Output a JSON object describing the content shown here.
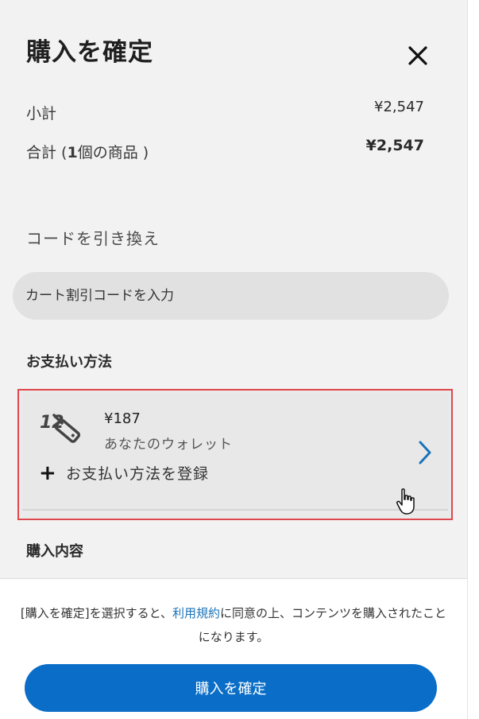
{
  "header": {
    "title": "購入を確定",
    "close_icon": "close-icon"
  },
  "summary": {
    "subtotal_label": "小計",
    "subtotal_value": "¥2,547",
    "total_label_prefix": "合計 (",
    "total_count": "1",
    "total_label_suffix": "個の商品 )",
    "total_value": "¥2,547"
  },
  "redeem": {
    "heading": "コードを引き換え",
    "input_placeholder": "カート割引コードを入力"
  },
  "payment": {
    "heading": "お支払い方法",
    "wallet_amount": "¥187",
    "wallet_label": "あなたのウォレット",
    "add_payment_label": "お支払い方法を登録",
    "highlight_color": "#e0474c"
  },
  "contents": {
    "heading": "購入内容"
  },
  "footer": {
    "terms_prefix": "[購入を確定]を選択すると、",
    "terms_link": "利用規約",
    "terms_suffix": "に同意の上、コンテンツを購入されたことになります。",
    "confirm_label": "購入を確定",
    "accent_color": "#0a6ec8"
  }
}
